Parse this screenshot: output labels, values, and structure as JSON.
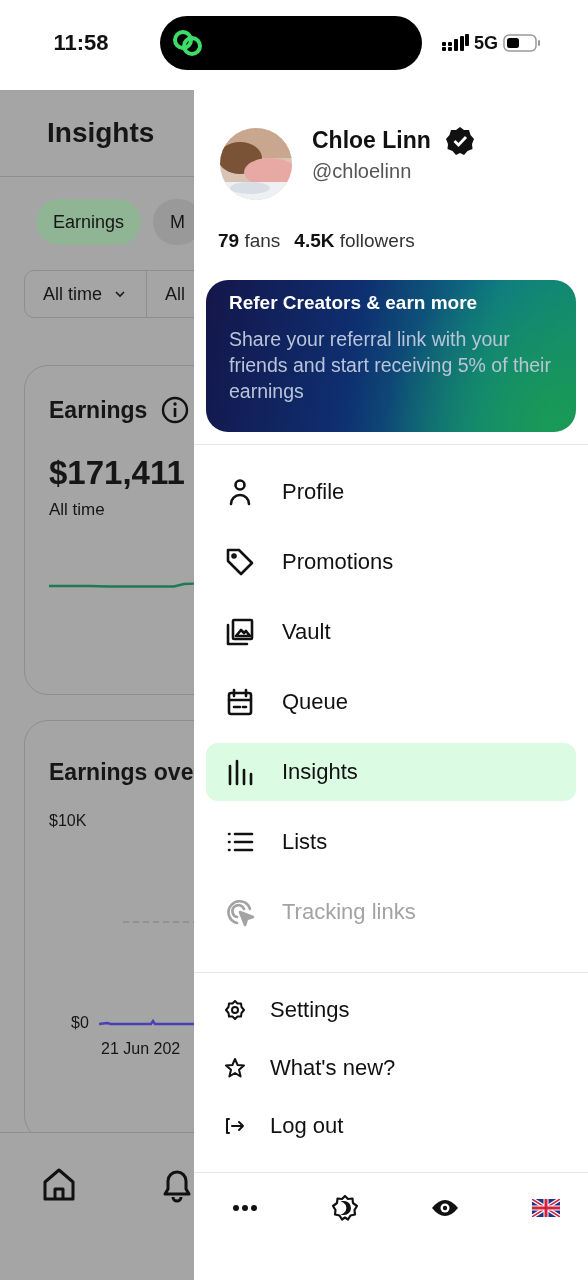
{
  "status_bar": {
    "time": "11:58",
    "network": "5G"
  },
  "background": {
    "title": "Insights",
    "chips": [
      {
        "label": "Earnings",
        "selected": true
      },
      {
        "label": "M",
        "selected": false
      }
    ],
    "filters": [
      {
        "label": "All time",
        "kind": "dropdown"
      },
      {
        "label": "All",
        "kind": "plain"
      }
    ],
    "earnings_card": {
      "title": "Earnings",
      "amount": "$171,411",
      "period": "All time"
    },
    "chart_card": {
      "title": "Earnings ove",
      "y_top": "$10K",
      "y_bottom": "$0",
      "x_start": "21 Jun 202"
    }
  },
  "drawer": {
    "profile": {
      "name": "Chloe Linn",
      "verified": true,
      "handle": "@chloelinn"
    },
    "stats": [
      "**79** fans",
      "**4.5K** followers"
    ],
    "referral": {
      "title": "Refer Creators & earn more",
      "text": "Share your referral link with your friends and start receiving 5% of their earnings"
    },
    "menu": [
      {
        "kind": "person",
        "label": "Profile",
        "selected": false,
        "disabled": false
      },
      {
        "kind": "tag",
        "label": "Promotions",
        "selected": false,
        "disabled": false
      },
      {
        "kind": "gallery",
        "label": "Vault",
        "selected": false,
        "disabled": false
      },
      {
        "kind": "calendar",
        "label": "Queue",
        "selected": false,
        "disabled": false
      },
      {
        "kind": "bars",
        "label": "Insights",
        "selected": true,
        "disabled": false
      },
      {
        "kind": "list",
        "label": "Lists",
        "selected": false,
        "disabled": false
      },
      {
        "kind": "target",
        "label": "Tracking links",
        "selected": false,
        "disabled": true
      }
    ],
    "secondary": [
      {
        "kind": "gear",
        "label": "Settings"
      },
      {
        "kind": "star",
        "label": "What's new?"
      },
      {
        "kind": "logout",
        "label": "Log out"
      }
    ],
    "toolbar": [
      {
        "kind": "more"
      },
      {
        "kind": "theme"
      },
      {
        "kind": "eye"
      },
      {
        "kind": "flag"
      }
    ]
  }
}
